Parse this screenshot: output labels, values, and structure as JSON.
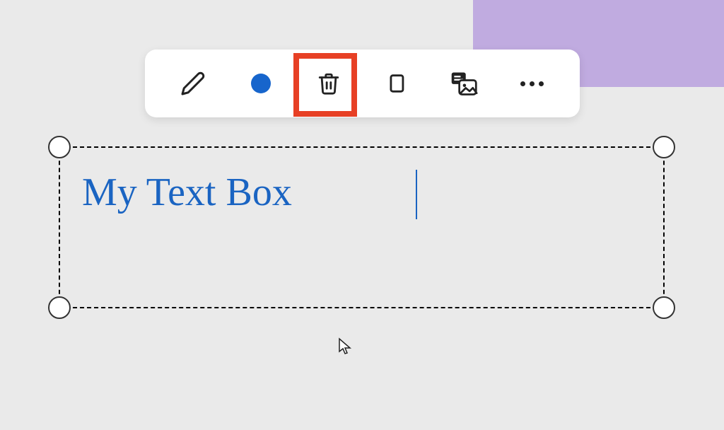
{
  "toolbar": {
    "items": [
      {
        "name": "edit-icon"
      },
      {
        "name": "color-circle-icon"
      },
      {
        "name": "trash-icon"
      },
      {
        "name": "copy-icon"
      },
      {
        "name": "note-image-icon"
      },
      {
        "name": "more-icon"
      }
    ]
  },
  "textbox": {
    "content": "My Text Box"
  },
  "colors": {
    "accent_blue": "#1765cc",
    "text_blue": "#1a64c2",
    "highlight_red": "#e74025",
    "purple_panel": "#c0abe0",
    "canvas_bg": "#eaeaea"
  }
}
